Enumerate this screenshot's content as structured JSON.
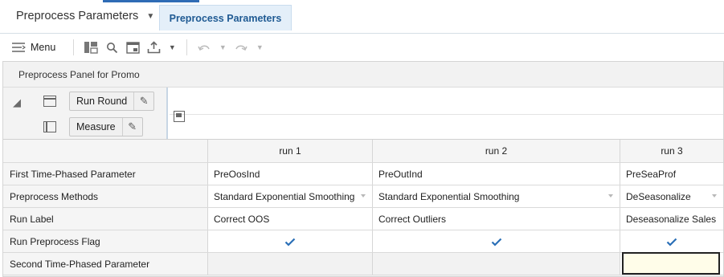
{
  "tabs": {
    "main_label": "Preprocess Parameters",
    "active_label": "Preprocess Parameters"
  },
  "toolbar": {
    "menu_label": "Menu",
    "icons": [
      "menu-lines-icon",
      "layout-icon",
      "search-icon",
      "view-icon",
      "export-icon",
      "chevron-down-icon",
      "undo-icon",
      "redo-icon"
    ]
  },
  "panel": {
    "title": "Preprocess Panel for Promo",
    "pivot": {
      "row_dimension": "Run Round",
      "column_dimension": "Measure"
    }
  },
  "grid": {
    "columns": [
      "run 1",
      "run 2",
      "run 3"
    ],
    "rows": [
      {
        "label": "First Time-Phased Parameter",
        "cells": [
          "PreOosInd",
          "PreOutInd",
          "PreSeaProf"
        ]
      },
      {
        "label": "Preprocess Methods",
        "cells": [
          "Standard Exponential Smoothing",
          "Standard Exponential Smoothing",
          "DeSeasonalize"
        ]
      },
      {
        "label": "Run Label",
        "cells": [
          "Correct OOS",
          "Correct Outliers",
          "Deseasonalize Sales"
        ]
      },
      {
        "label": "Run Preprocess Flag",
        "checked": [
          true,
          true,
          true
        ]
      },
      {
        "label": "Second Time-Phased Parameter",
        "cells": [
          "",
          "",
          ""
        ]
      }
    ]
  },
  "colors": {
    "accent": "#2f6cb5",
    "active_tab_bg": "#e4eff9",
    "check": "#2a6fb7",
    "selected_cell_bg": "#fffde9"
  }
}
